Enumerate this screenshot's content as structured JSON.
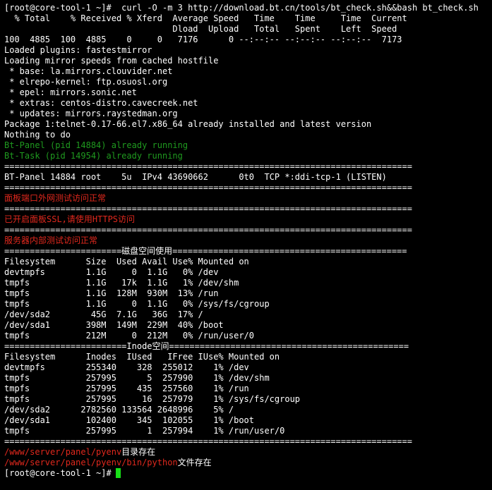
{
  "terminal": {
    "colors": {
      "background": "#000000",
      "text": "#ffffff",
      "green": "#1f9a1f",
      "red": "#e0281d",
      "cursor": "#18e018"
    },
    "cursor_icon": "block-cursor",
    "lines": [
      {
        "type": "normal",
        "text": "[root@core-tool-1 ~]#  curl -O -m 3 http://download.bt.cn/tools/bt_check.sh&&bash bt_check.sh"
      },
      {
        "type": "normal",
        "text": "  % Total    % Received % Xferd  Average Speed   Time    Time     Time  Current"
      },
      {
        "type": "normal",
        "text": "                                 Dload  Upload   Total   Spent    Left  Speed"
      },
      {
        "type": "normal",
        "text": "100  4885  100  4885    0     0   7176      0 --:--:-- --:--:-- --:--:--  7173"
      },
      {
        "type": "normal",
        "text": "Loaded plugins: fastestmirror"
      },
      {
        "type": "normal",
        "text": "Loading mirror speeds from cached hostfile"
      },
      {
        "type": "normal",
        "text": " * base: la.mirrors.clouvider.net"
      },
      {
        "type": "normal",
        "text": " * elrepo-kernel: ftp.osuosl.org"
      },
      {
        "type": "normal",
        "text": " * epel: mirrors.sonic.net"
      },
      {
        "type": "normal",
        "text": " * extras: centos-distro.cavecreek.net"
      },
      {
        "type": "normal",
        "text": " * updates: mirrors.raystedman.org"
      },
      {
        "type": "normal",
        "text": "Package 1:telnet-0.17-66.el7.x86_64 already installed and latest version"
      },
      {
        "type": "normal",
        "text": "Nothing to do"
      },
      {
        "type": "green",
        "text": "Bt-Panel (pid 14884) already running"
      },
      {
        "type": "green",
        "text": "Bt-Task (pid 14954) already running"
      },
      {
        "type": "normal",
        "text": "================================================================================"
      },
      {
        "type": "normal",
        "text": "BT-Panel 14884 root    5u  IPv4 43690662      0t0  TCP *:ddi-tcp-1 (LISTEN)"
      },
      {
        "type": "normal",
        "text": "================================================================================"
      },
      {
        "type": "red",
        "text": "面板端口外网测试访问正常"
      },
      {
        "type": "normal",
        "text": "================================================================================"
      },
      {
        "type": "red",
        "text": "已开启面板SSL,请使用HTTPS访问"
      },
      {
        "type": "normal",
        "text": "================================================================================"
      },
      {
        "type": "red",
        "text": "服务器内部测试访问正常"
      },
      {
        "type": "normal",
        "text": "=======================磁盘空间使用=============================================="
      },
      {
        "type": "normal",
        "text": "Filesystem      Size  Used Avail Use% Mounted on"
      },
      {
        "type": "normal",
        "text": "devtmpfs        1.1G     0  1.1G   0% /dev"
      },
      {
        "type": "normal",
        "text": "tmpfs           1.1G   17k  1.1G   1% /dev/shm"
      },
      {
        "type": "normal",
        "text": "tmpfs           1.1G  128M  930M  13% /run"
      },
      {
        "type": "normal",
        "text": "tmpfs           1.1G     0  1.1G   0% /sys/fs/cgroup"
      },
      {
        "type": "normal",
        "text": "/dev/sda2        45G  7.1G   36G  17% /"
      },
      {
        "type": "normal",
        "text": "/dev/sda1       398M  149M  229M  40% /boot"
      },
      {
        "type": "normal",
        "text": "tmpfs           212M     0  212M   0% /run/user/0"
      },
      {
        "type": "normal",
        "text": "========================Inode空间==============================================="
      },
      {
        "type": "normal",
        "text": "Filesystem      Inodes  IUsed   IFree IUse% Mounted on"
      },
      {
        "type": "normal",
        "text": "devtmpfs        255340    328  255012    1% /dev"
      },
      {
        "type": "normal",
        "text": "tmpfs           257995      5  257990    1% /dev/shm"
      },
      {
        "type": "normal",
        "text": "tmpfs           257995    435  257560    1% /run"
      },
      {
        "type": "normal",
        "text": "tmpfs           257995     16  257979    1% /sys/fs/cgroup"
      },
      {
        "type": "normal",
        "text": "/dev/sda2      2782560 133564 2648996    5% /"
      },
      {
        "type": "normal",
        "text": "/dev/sda1       102400    345  102055    1% /boot"
      },
      {
        "type": "normal",
        "text": "tmpfs           257995      1  257994    1% /run/user/0"
      },
      {
        "type": "normal",
        "text": "================================================================================"
      },
      {
        "type": "mixed",
        "red": "/www/server/panel/pyenv",
        "white": "目录存在"
      },
      {
        "type": "mixed",
        "red": "/www/server/panel/pyenv/bin/python",
        "white": "文件存在"
      },
      {
        "type": "prompt",
        "text": "[root@core-tool-1 ~]#"
      }
    ]
  }
}
